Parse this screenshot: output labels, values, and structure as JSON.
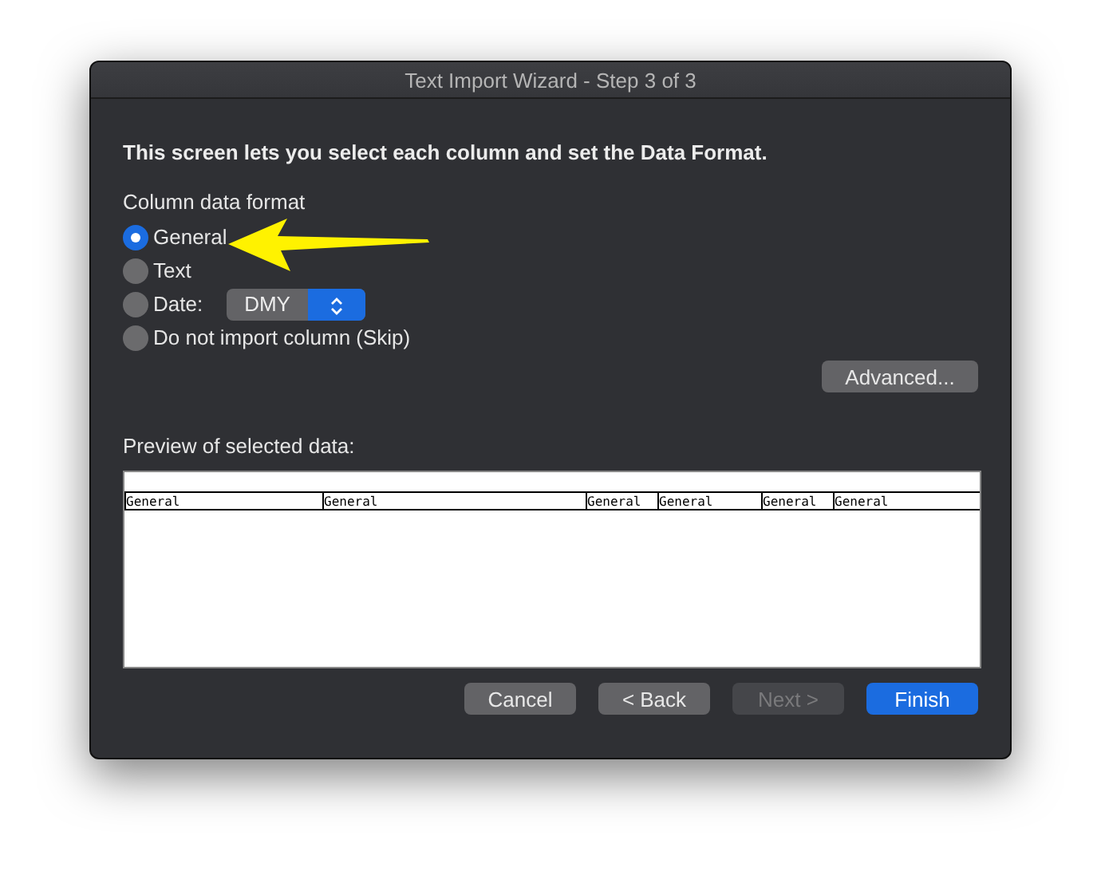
{
  "window": {
    "title": "Text Import Wizard - Step 3 of 3"
  },
  "instruction": "This screen lets you select each column and set the Data Format.",
  "format_group": {
    "label": "Column data format",
    "options": [
      {
        "label": "General",
        "selected": true
      },
      {
        "label": "Text",
        "selected": false
      },
      {
        "label": "Date:",
        "selected": false,
        "dropdown": "DMY"
      },
      {
        "label": "Do not import column (Skip)",
        "selected": false
      }
    ]
  },
  "advanced_button": "Advanced...",
  "preview": {
    "label": "Preview of selected data:",
    "columns": [
      "General",
      "General",
      "General",
      "General",
      "General",
      "General"
    ]
  },
  "buttons": [
    {
      "label": "Cancel",
      "disabled": false,
      "default": false
    },
    {
      "label": "< Back",
      "disabled": false,
      "default": false
    },
    {
      "label": "Next >",
      "disabled": true,
      "default": false
    },
    {
      "label": "Finish",
      "disabled": false,
      "default": true
    }
  ],
  "annotation": {
    "kind": "arrow"
  }
}
